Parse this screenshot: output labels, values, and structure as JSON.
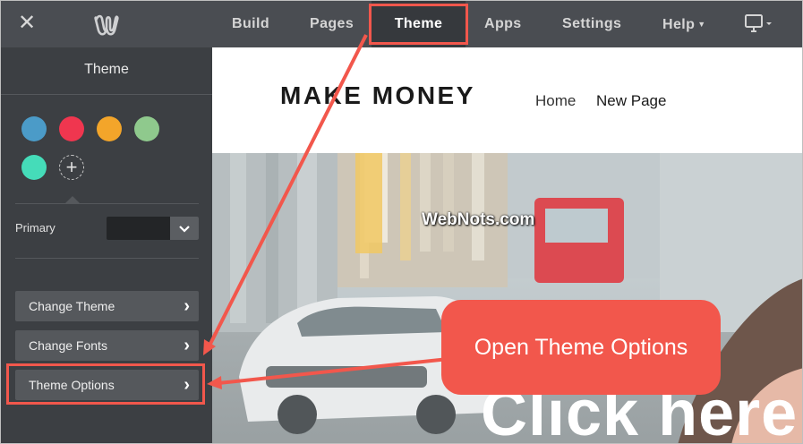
{
  "topbar": {
    "nav": [
      {
        "label": "Build"
      },
      {
        "label": "Pages"
      },
      {
        "label": "Theme"
      },
      {
        "label": "Apps"
      },
      {
        "label": "Settings"
      },
      {
        "label": "Help"
      }
    ],
    "active_tab": "Theme"
  },
  "sidebar": {
    "title": "Theme",
    "swatches": [
      "#4b9bc8",
      "#f0364f",
      "#f3a52a",
      "#8fc98d",
      "#45dcb9"
    ],
    "primary_label": "Primary",
    "primary_value": "",
    "buttons": [
      {
        "label": "Change Theme"
      },
      {
        "label": "Change Fonts"
      },
      {
        "label": "Theme Options"
      }
    ]
  },
  "preview": {
    "site_title": "MAKE MONEY",
    "nav": [
      "Home",
      "New Page"
    ],
    "hero_text": "Click here"
  },
  "annotations": {
    "watermark": "WebNots.com",
    "callout": "Open Theme Options",
    "highlight_color": "#f2574c"
  },
  "colors": {
    "topbar": "#4a4d52",
    "sidebar": "#3c3f43",
    "accent": "#f2574c"
  }
}
